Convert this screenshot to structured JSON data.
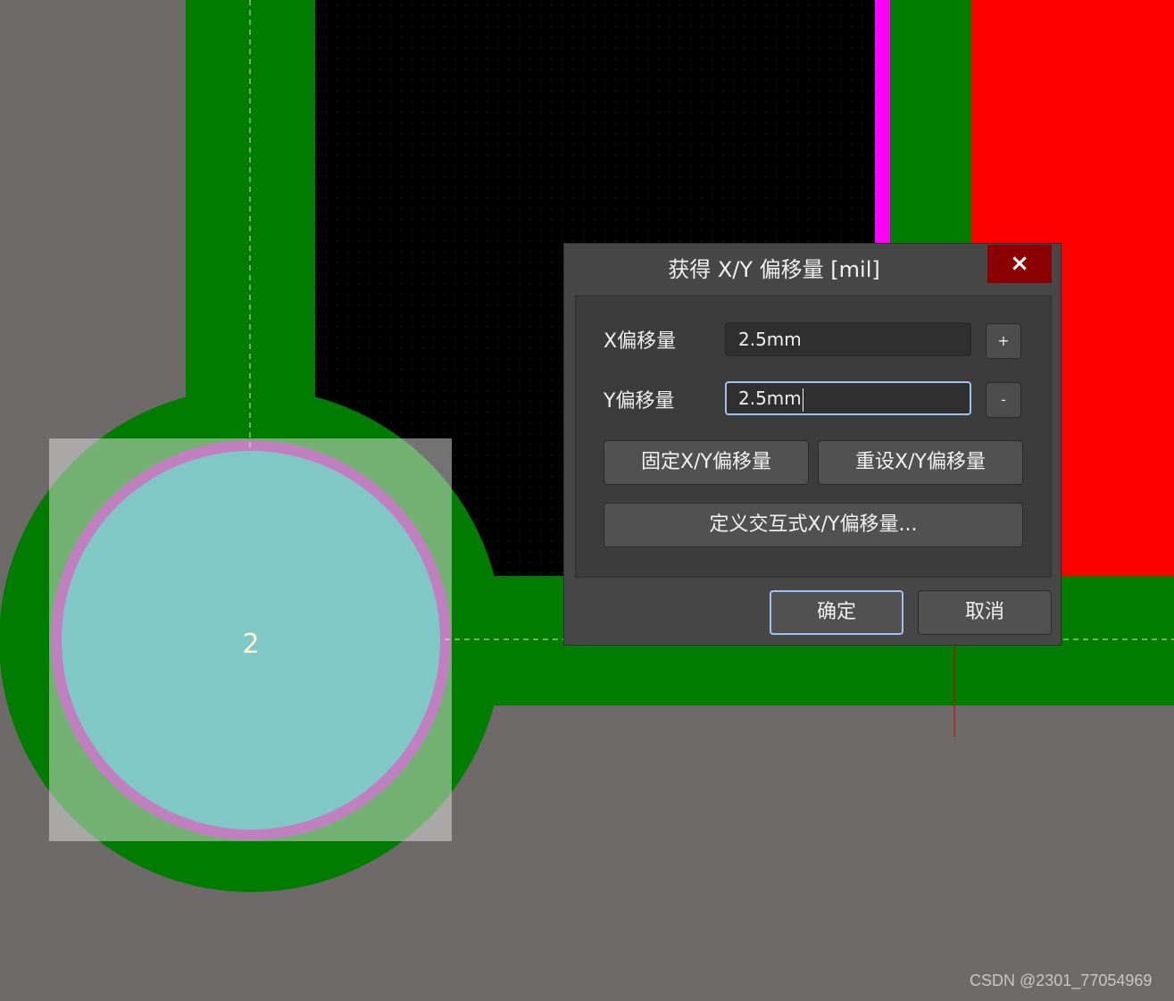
{
  "canvas": {
    "pad_number": "2",
    "colors": {
      "background": "#6e6a69",
      "copper": "#007c00",
      "void": "#000000",
      "red_region": "#ff0000",
      "magenta_track": "#ff00ff",
      "pad_fill": "#80c8c5",
      "pad_ring": "#c080c0",
      "selection_box": "#cccccc"
    }
  },
  "dialog": {
    "title": "获得 X/Y 偏移量 [mil]",
    "close_icon": "×",
    "x_offset": {
      "label": "X偏移量",
      "value": "2.5mm",
      "button": "+"
    },
    "y_offset": {
      "label": "Y偏移量",
      "value": "2.5mm",
      "button": "-"
    },
    "fix_button": "固定X/Y偏移量",
    "reset_button": "重设X/Y偏移量",
    "define_button": "定义交互式X/Y偏移量...",
    "ok_button": "确定",
    "cancel_button": "取消"
  },
  "watermark": "CSDN @2301_77054969"
}
